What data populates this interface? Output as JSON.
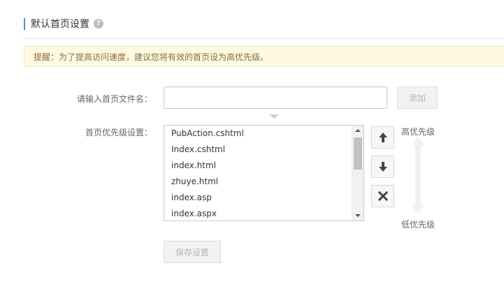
{
  "section": {
    "title": "默认首页设置",
    "help_glyph": "?"
  },
  "tip": {
    "text": "提醒：为了提高访问速度，建议您将有效的首页设为高优先级。"
  },
  "form": {
    "filename_label": "请输入首页文件名：",
    "filename_value": "",
    "add_button": "添加",
    "priority_label": "首页优先级设置：",
    "priority_list": [
      "PubAction.cshtml",
      "Index.cshtml",
      "index.html",
      "zhuye.html",
      "index.asp",
      "index.aspx"
    ],
    "high_priority": "高优先级",
    "low_priority": "低优先级",
    "save_button": "保存设置"
  },
  "icons": {
    "help": "question-circle-icon",
    "move_up": "arrow-up-icon",
    "move_down": "arrow-down-icon",
    "delete": "close-icon"
  },
  "colors": {
    "accent": "#4a90d9",
    "tip_bg": "#fdf8e1",
    "tip_text": "#8a6d3b",
    "disabled_text": "#b5b5b5"
  }
}
